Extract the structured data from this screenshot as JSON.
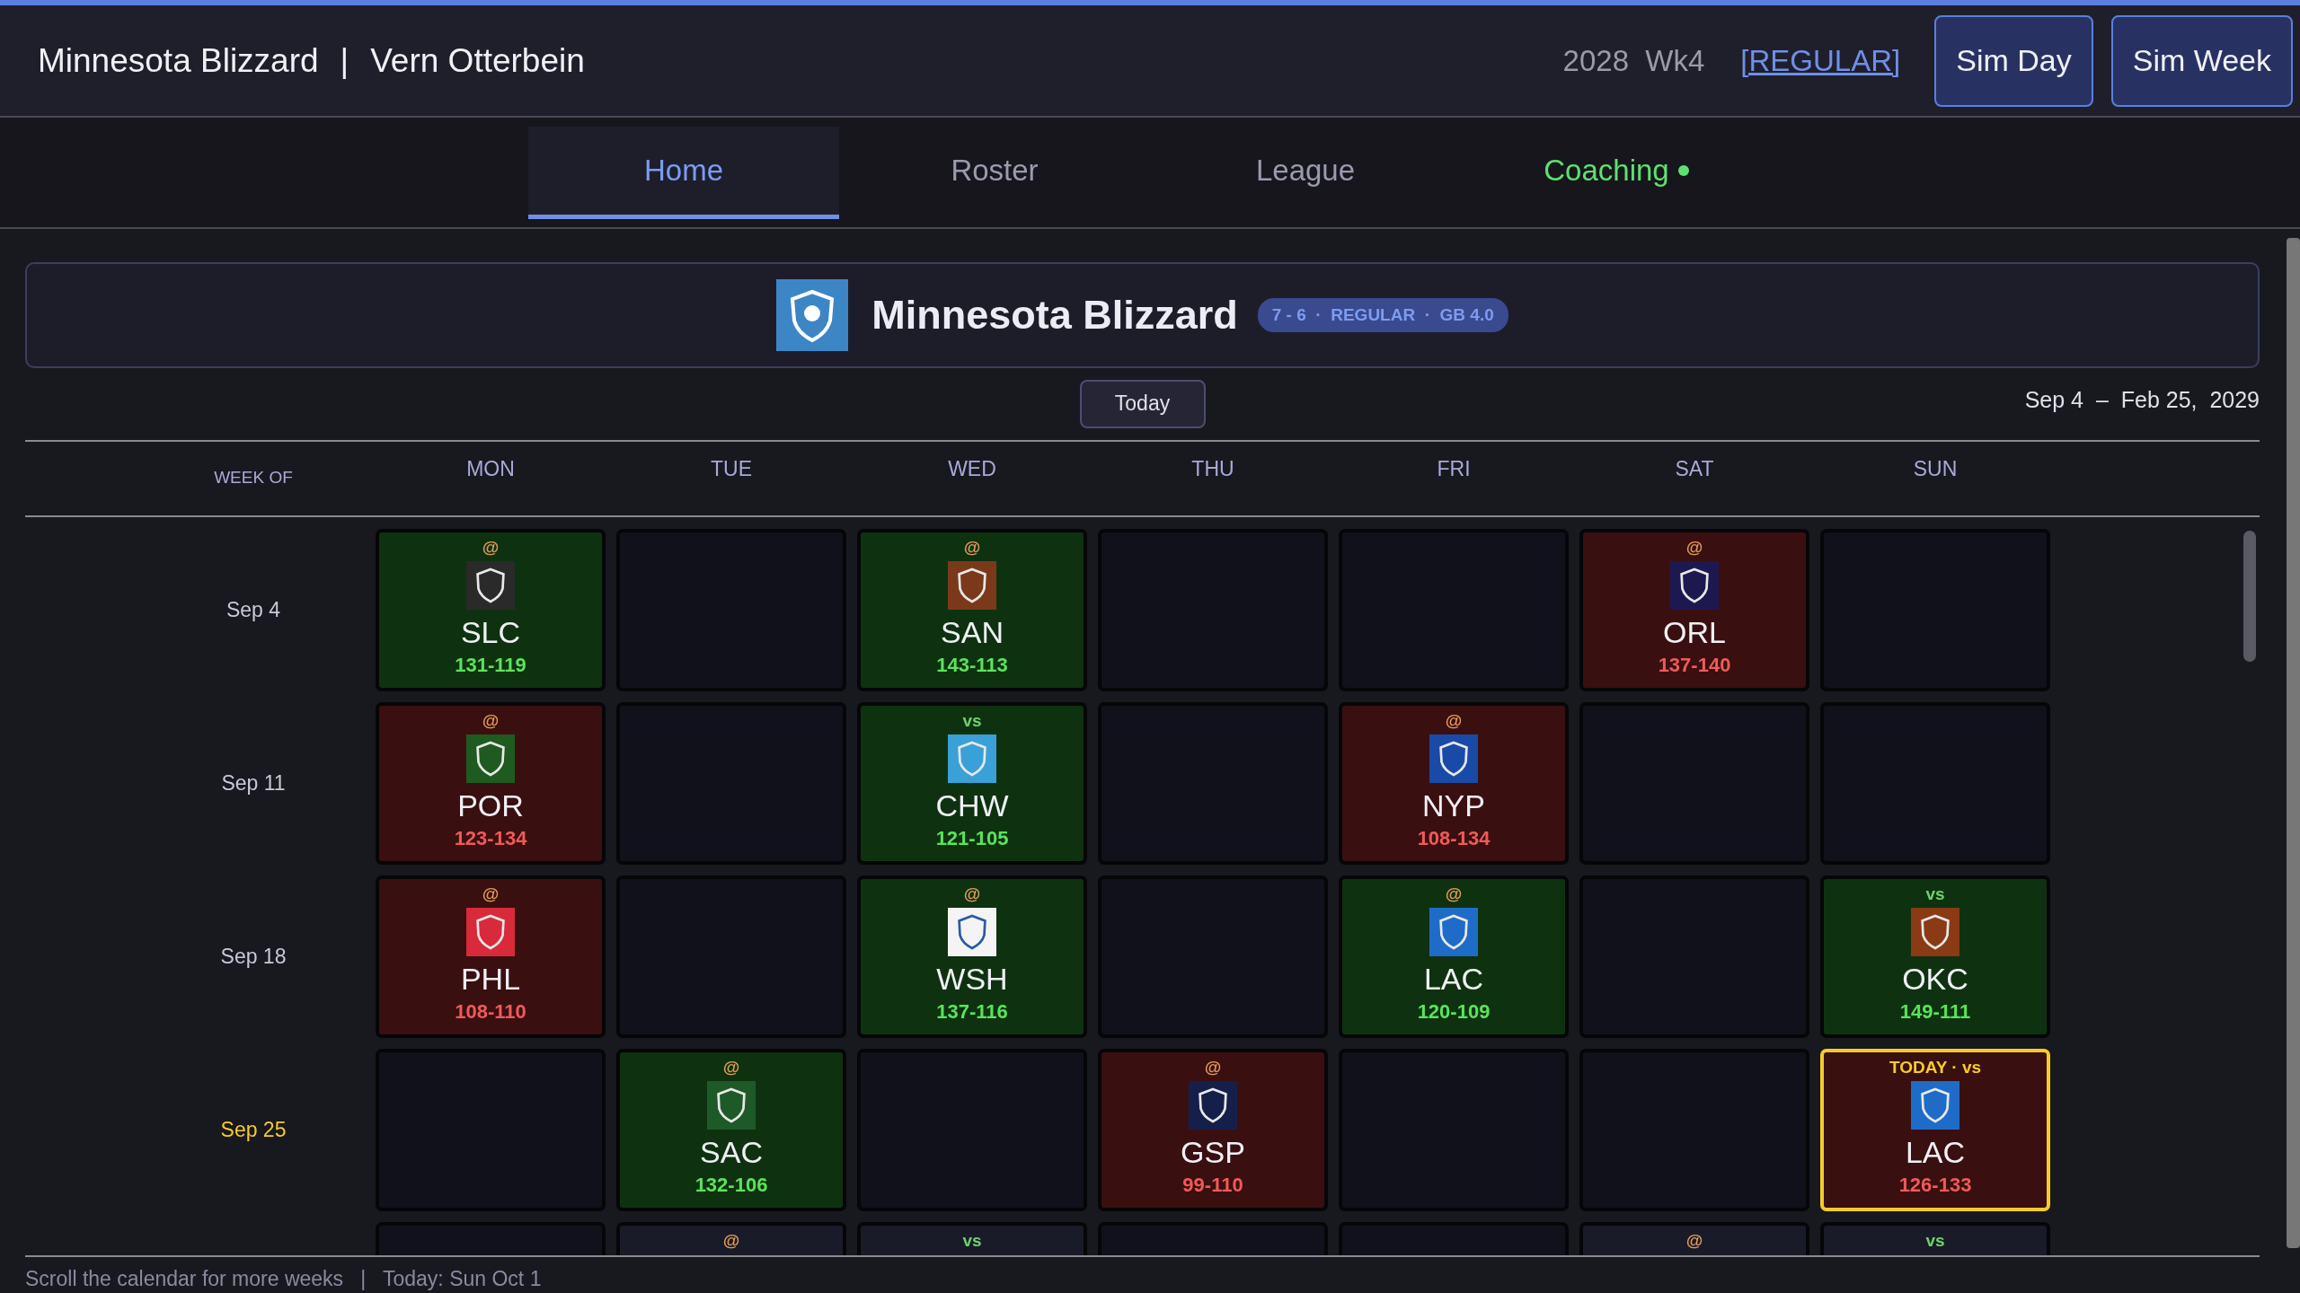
{
  "header": {
    "team": "Minnesota Blizzard",
    "separator": "|",
    "manager": "Vern Otterbein",
    "season": "2028  Wk4",
    "phase": "[REGULAR]",
    "buttons": [
      "Sim Day",
      "Sim Week"
    ]
  },
  "tabs": [
    {
      "label": "Home",
      "selected": true,
      "alert": false
    },
    {
      "label": "Roster",
      "selected": false,
      "alert": false
    },
    {
      "label": "League",
      "selected": false,
      "alert": false
    },
    {
      "label": "Coaching",
      "selected": false,
      "alert": true
    }
  ],
  "banner": {
    "title": "Minnesota Blizzard",
    "badge": "7 - 6  ·  REGULAR  ·  GB 4.0",
    "color": "#3d86c6"
  },
  "toolbar": {
    "today_button": "Today",
    "date_range": "Sep 4  –  Feb 25,  2029"
  },
  "calendar": {
    "week_heading": "WEEK OF",
    "days": [
      "MON",
      "TUE",
      "WED",
      "THU",
      "FRI",
      "SAT",
      "SUN"
    ],
    "weeks": [
      {
        "label": "Sep 4",
        "current": false,
        "cells": [
          {
            "kind": "game",
            "away": true,
            "marker": "@",
            "team": "SLC",
            "score": "131-119",
            "won": true,
            "today": false,
            "color": "#2a2a2a"
          },
          {
            "kind": "empty"
          },
          {
            "kind": "game",
            "away": true,
            "marker": "@",
            "team": "SAN",
            "score": "143-113",
            "won": true,
            "today": false,
            "color": "#7a3a1a"
          },
          {
            "kind": "empty"
          },
          {
            "kind": "empty"
          },
          {
            "kind": "game",
            "away": true,
            "marker": "@",
            "team": "ORL",
            "score": "137-140",
            "won": false,
            "today": false,
            "color": "#1e1850"
          },
          {
            "kind": "empty"
          }
        ]
      },
      {
        "label": "Sep 11",
        "current": false,
        "cells": [
          {
            "kind": "game",
            "away": true,
            "marker": "@",
            "team": "POR",
            "score": "123-134",
            "won": false,
            "today": false,
            "color": "#1f5a20"
          },
          {
            "kind": "empty"
          },
          {
            "kind": "game",
            "away": false,
            "marker": "vs",
            "team": "CHW",
            "score": "121-105",
            "won": true,
            "today": false,
            "color": "#3aa0d8"
          },
          {
            "kind": "empty"
          },
          {
            "kind": "game",
            "away": true,
            "marker": "@",
            "team": "NYP",
            "score": "108-134",
            "won": false,
            "today": false,
            "color": "#1a4aa8"
          },
          {
            "kind": "empty"
          },
          {
            "kind": "empty"
          }
        ]
      },
      {
        "label": "Sep 18",
        "current": false,
        "cells": [
          {
            "kind": "game",
            "away": true,
            "marker": "@",
            "team": "PHL",
            "score": "108-110",
            "won": false,
            "today": false,
            "color": "#d82a3a"
          },
          {
            "kind": "empty"
          },
          {
            "kind": "game",
            "away": true,
            "marker": "@",
            "team": "WSH",
            "score": "137-116",
            "won": true,
            "today": false,
            "color": "#f4f4f4"
          },
          {
            "kind": "empty"
          },
          {
            "kind": "game",
            "away": true,
            "marker": "@",
            "team": "LAC",
            "score": "120-109",
            "won": true,
            "today": false,
            "color": "#1f6cc8"
          },
          {
            "kind": "empty"
          },
          {
            "kind": "game",
            "away": false,
            "marker": "vs",
            "team": "OKC",
            "score": "149-111",
            "won": true,
            "today": false,
            "color": "#8a3a14"
          }
        ]
      },
      {
        "label": "Sep 25",
        "current": true,
        "cells": [
          {
            "kind": "empty"
          },
          {
            "kind": "game",
            "away": true,
            "marker": "@",
            "team": "SAC",
            "score": "132-106",
            "won": true,
            "today": false,
            "color": "#1e5a28"
          },
          {
            "kind": "empty"
          },
          {
            "kind": "game",
            "away": true,
            "marker": "@",
            "team": "GSP",
            "score": "99-110",
            "won": false,
            "today": false,
            "color": "#14204a"
          },
          {
            "kind": "empty"
          },
          {
            "kind": "empty"
          },
          {
            "kind": "game",
            "marker": "TODAY · vs",
            "team": "LAC",
            "score": "126-133",
            "won": false,
            "today": true,
            "color": "#1f6cc8"
          }
        ]
      },
      {
        "cells": [
          {
            "kind": "empty"
          },
          {
            "kind": "upcoming",
            "away": true,
            "marker": "@"
          },
          {
            "kind": "upcoming",
            "away": false,
            "marker": "vs"
          },
          {
            "kind": "empty"
          },
          {
            "kind": "empty"
          },
          {
            "kind": "upcoming",
            "away": true,
            "marker": "@"
          },
          {
            "kind": "upcoming",
            "away": false,
            "marker": "vs"
          }
        ]
      }
    ]
  },
  "footer": "Scroll the calendar for more weeks   |   Today: Sun Oct 1"
}
